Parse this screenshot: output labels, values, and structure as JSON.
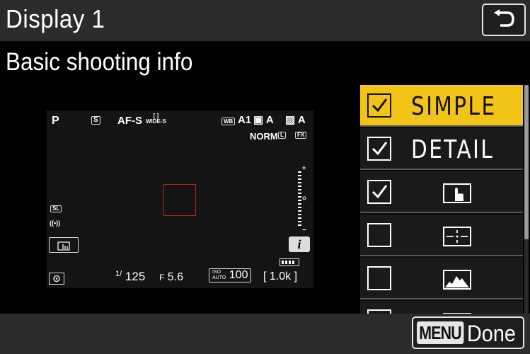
{
  "header": {
    "title": "Display 1",
    "back_icon": "return-arrow-icon"
  },
  "subtitle": "Basic shooting info",
  "preview": {
    "mode": "P",
    "s_badge": "S",
    "focus_mode": "AF-S",
    "area_top": "[ ]",
    "area_bottom": "WIDE-S",
    "wb_tag": "WB",
    "wb_value": "A1",
    "pc_value": "A",
    "adl_value": "A",
    "quality": "NORM",
    "fx": "FX",
    "shutter_prefix": "1/",
    "shutter": "125",
    "aperture_prefix": "F",
    "aperture": "5.6",
    "iso_top": "ISO",
    "iso_bottom": "AUTO",
    "iso_value": "100",
    "frames": "[ 1.0k ]",
    "info_label": "i",
    "vr_label": "((•))"
  },
  "list": {
    "items": [
      {
        "label": "SIMPLE",
        "checked": true,
        "selected": true
      },
      {
        "label": "DETAIL",
        "checked": true,
        "selected": false
      },
      {
        "label": "",
        "icon": "touch-hand-icon",
        "checked": true,
        "selected": false
      },
      {
        "label": "",
        "icon": "level-crosshair-icon",
        "checked": false,
        "selected": false
      },
      {
        "label": "",
        "icon": "histogram-icon",
        "checked": false,
        "selected": false
      },
      {
        "label": "",
        "icon": "grid-icon",
        "checked": false,
        "selected": false
      }
    ]
  },
  "footer": {
    "menu_label": "MENU",
    "done_label": "Done"
  },
  "colors": {
    "selected": "#f3c418",
    "focus_frame": "#c0201e"
  }
}
